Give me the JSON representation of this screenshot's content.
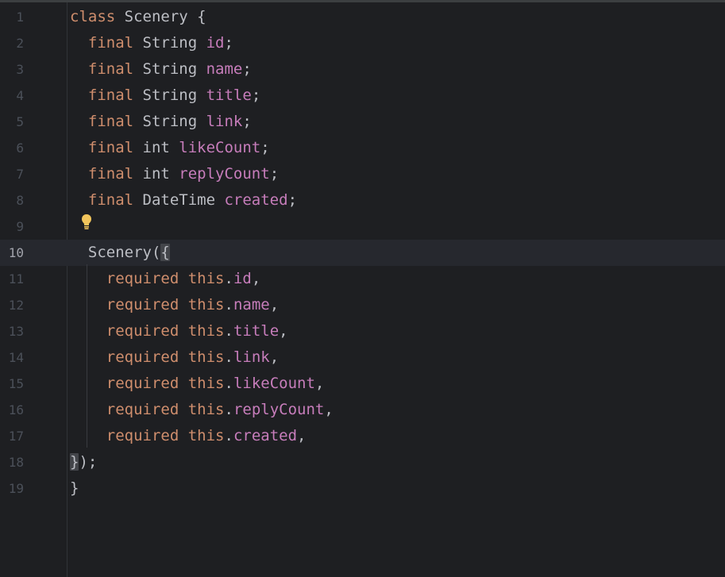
{
  "editor": {
    "current_line": "10",
    "bulb_icon": "lightbulb-icon",
    "colors": {
      "background": "#1e1f22",
      "keyword": "#cf8e6d",
      "field": "#c77dbb",
      "text": "#bcbec4",
      "line_number": "#4b5059",
      "current_line_bg": "#26282e",
      "bulb": "#f2c55c"
    },
    "lines": [
      {
        "num": "1",
        "tokens": [
          {
            "t": "class",
            "c": "kw"
          },
          {
            "t": " Scenery {",
            "c": "cls"
          }
        ]
      },
      {
        "num": "2",
        "tokens": [
          {
            "t": "  ",
            "c": "punc"
          },
          {
            "t": "final",
            "c": "kw"
          },
          {
            "t": " String ",
            "c": "typ"
          },
          {
            "t": "id",
            "c": "fld"
          },
          {
            "t": ";",
            "c": "punc"
          }
        ]
      },
      {
        "num": "3",
        "tokens": [
          {
            "t": "  ",
            "c": "punc"
          },
          {
            "t": "final",
            "c": "kw"
          },
          {
            "t": " String ",
            "c": "typ"
          },
          {
            "t": "name",
            "c": "fld"
          },
          {
            "t": ";",
            "c": "punc"
          }
        ]
      },
      {
        "num": "4",
        "tokens": [
          {
            "t": "  ",
            "c": "punc"
          },
          {
            "t": "final",
            "c": "kw"
          },
          {
            "t": " String ",
            "c": "typ"
          },
          {
            "t": "title",
            "c": "fld"
          },
          {
            "t": ";",
            "c": "punc"
          }
        ]
      },
      {
        "num": "5",
        "tokens": [
          {
            "t": "  ",
            "c": "punc"
          },
          {
            "t": "final",
            "c": "kw"
          },
          {
            "t": " String ",
            "c": "typ"
          },
          {
            "t": "link",
            "c": "fld"
          },
          {
            "t": ";",
            "c": "punc"
          }
        ]
      },
      {
        "num": "6",
        "tokens": [
          {
            "t": "  ",
            "c": "punc"
          },
          {
            "t": "final",
            "c": "kw"
          },
          {
            "t": " int ",
            "c": "typ"
          },
          {
            "t": "likeCount",
            "c": "fld"
          },
          {
            "t": ";",
            "c": "punc"
          }
        ]
      },
      {
        "num": "7",
        "tokens": [
          {
            "t": "  ",
            "c": "punc"
          },
          {
            "t": "final",
            "c": "kw"
          },
          {
            "t": " int ",
            "c": "typ"
          },
          {
            "t": "replyCount",
            "c": "fld"
          },
          {
            "t": ";",
            "c": "punc"
          }
        ]
      },
      {
        "num": "8",
        "tokens": [
          {
            "t": "  ",
            "c": "punc"
          },
          {
            "t": "final",
            "c": "kw"
          },
          {
            "t": " DateTime ",
            "c": "typ"
          },
          {
            "t": "created",
            "c": "fld"
          },
          {
            "t": ";",
            "c": "punc"
          }
        ]
      },
      {
        "num": "9",
        "tokens": []
      },
      {
        "num": "10",
        "tokens": [
          {
            "t": "  Scenery(",
            "c": "cls"
          },
          {
            "t": "{",
            "c": "brace-hl"
          }
        ]
      },
      {
        "num": "11",
        "tokens": [
          {
            "t": "    ",
            "c": "punc"
          },
          {
            "t": "required",
            "c": "kw"
          },
          {
            "t": " ",
            "c": "punc"
          },
          {
            "t": "this",
            "c": "kw"
          },
          {
            "t": ".",
            "c": "punc"
          },
          {
            "t": "id",
            "c": "fld"
          },
          {
            "t": ",",
            "c": "punc"
          }
        ]
      },
      {
        "num": "12",
        "tokens": [
          {
            "t": "    ",
            "c": "punc"
          },
          {
            "t": "required",
            "c": "kw"
          },
          {
            "t": " ",
            "c": "punc"
          },
          {
            "t": "this",
            "c": "kw"
          },
          {
            "t": ".",
            "c": "punc"
          },
          {
            "t": "name",
            "c": "fld"
          },
          {
            "t": ",",
            "c": "punc"
          }
        ]
      },
      {
        "num": "13",
        "tokens": [
          {
            "t": "    ",
            "c": "punc"
          },
          {
            "t": "required",
            "c": "kw"
          },
          {
            "t": " ",
            "c": "punc"
          },
          {
            "t": "this",
            "c": "kw"
          },
          {
            "t": ".",
            "c": "punc"
          },
          {
            "t": "title",
            "c": "fld"
          },
          {
            "t": ",",
            "c": "punc"
          }
        ]
      },
      {
        "num": "14",
        "tokens": [
          {
            "t": "    ",
            "c": "punc"
          },
          {
            "t": "required",
            "c": "kw"
          },
          {
            "t": " ",
            "c": "punc"
          },
          {
            "t": "this",
            "c": "kw"
          },
          {
            "t": ".",
            "c": "punc"
          },
          {
            "t": "link",
            "c": "fld"
          },
          {
            "t": ",",
            "c": "punc"
          }
        ]
      },
      {
        "num": "15",
        "tokens": [
          {
            "t": "    ",
            "c": "punc"
          },
          {
            "t": "required",
            "c": "kw"
          },
          {
            "t": " ",
            "c": "punc"
          },
          {
            "t": "this",
            "c": "kw"
          },
          {
            "t": ".",
            "c": "punc"
          },
          {
            "t": "likeCount",
            "c": "fld"
          },
          {
            "t": ",",
            "c": "punc"
          }
        ]
      },
      {
        "num": "16",
        "tokens": [
          {
            "t": "    ",
            "c": "punc"
          },
          {
            "t": "required",
            "c": "kw"
          },
          {
            "t": " ",
            "c": "punc"
          },
          {
            "t": "this",
            "c": "kw"
          },
          {
            "t": ".",
            "c": "punc"
          },
          {
            "t": "replyCount",
            "c": "fld"
          },
          {
            "t": ",",
            "c": "punc"
          }
        ]
      },
      {
        "num": "17",
        "tokens": [
          {
            "t": "    ",
            "c": "punc"
          },
          {
            "t": "required",
            "c": "kw"
          },
          {
            "t": " ",
            "c": "punc"
          },
          {
            "t": "this",
            "c": "kw"
          },
          {
            "t": ".",
            "c": "punc"
          },
          {
            "t": "created",
            "c": "fld"
          },
          {
            "t": ",",
            "c": "punc"
          }
        ]
      },
      {
        "num": "18",
        "tokens": [
          {
            "t": "}",
            "c": "brace-hl"
          },
          {
            "t": ");",
            "c": "punc"
          }
        ]
      },
      {
        "num": "19",
        "tokens": [
          {
            "t": "}",
            "c": "punc"
          }
        ]
      }
    ]
  }
}
